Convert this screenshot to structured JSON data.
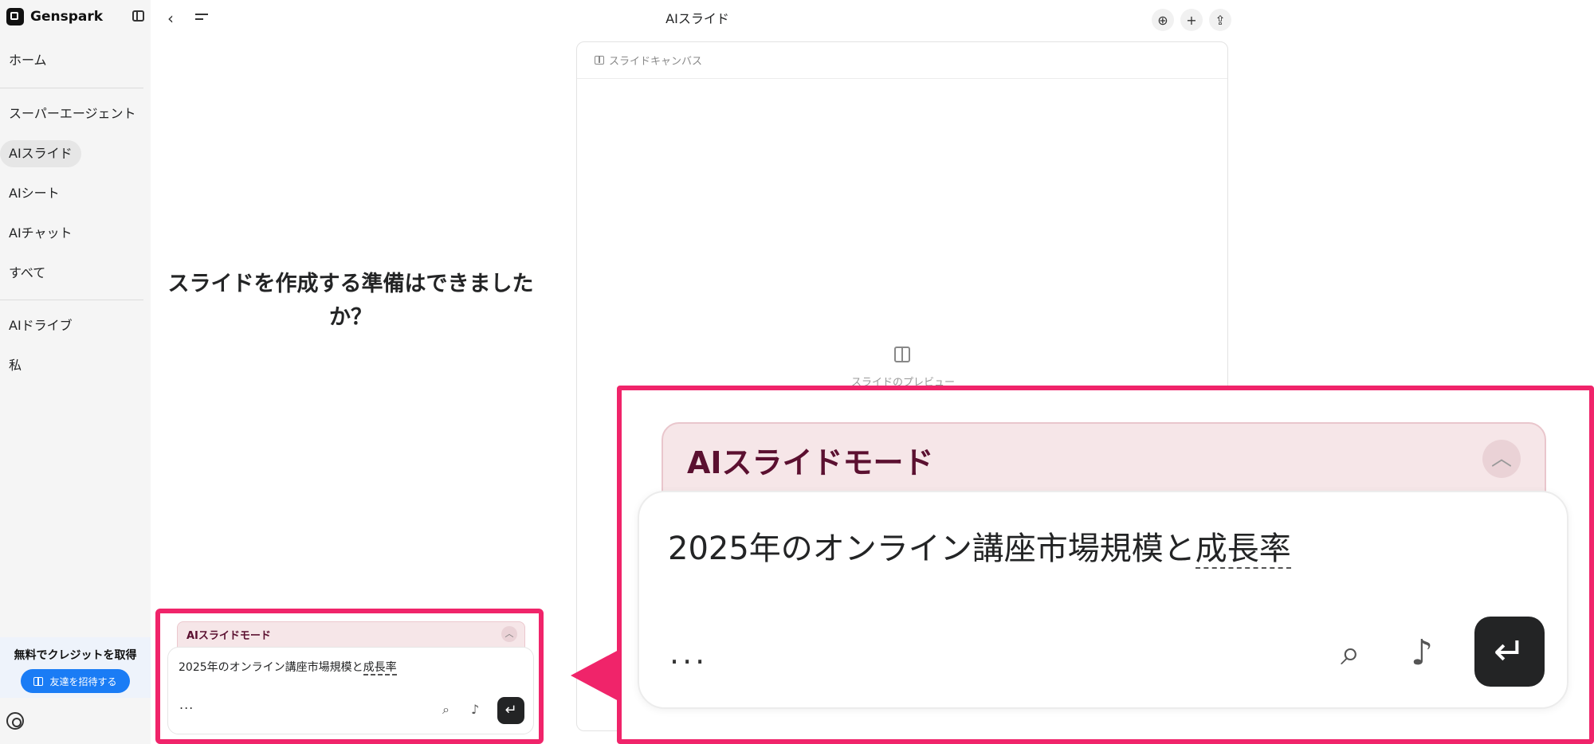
{
  "brand": {
    "name": "Genspark"
  },
  "sidebar": {
    "items": [
      {
        "label": "ホーム"
      },
      {
        "label": "スーパーエージェント"
      },
      {
        "label": "AIスライド"
      },
      {
        "label": "AIシート"
      },
      {
        "label": "AIチャット"
      },
      {
        "label": "すべて"
      },
      {
        "label": "AIドライブ"
      },
      {
        "label": "私"
      }
    ],
    "promo": {
      "title": "無料でクレジットを取得",
      "button": "友達を招待する"
    }
  },
  "header": {
    "title": "AIスライド"
  },
  "canvas": {
    "header_label": "スライドキャンバス",
    "preview_label": "スライドのプレビュー"
  },
  "main": {
    "heading": "スライドを作成する準備はできましたか？"
  },
  "composer": {
    "mode_label": "AIスライドモード",
    "input_text_main": "2025年のオンライン講座市場規模と",
    "input_text_underlined": "成長率",
    "more_label": "..."
  },
  "colors": {
    "highlight": "#f0246a",
    "accent": "#1a7cf5",
    "mode_bg": "#f6e6e8"
  }
}
